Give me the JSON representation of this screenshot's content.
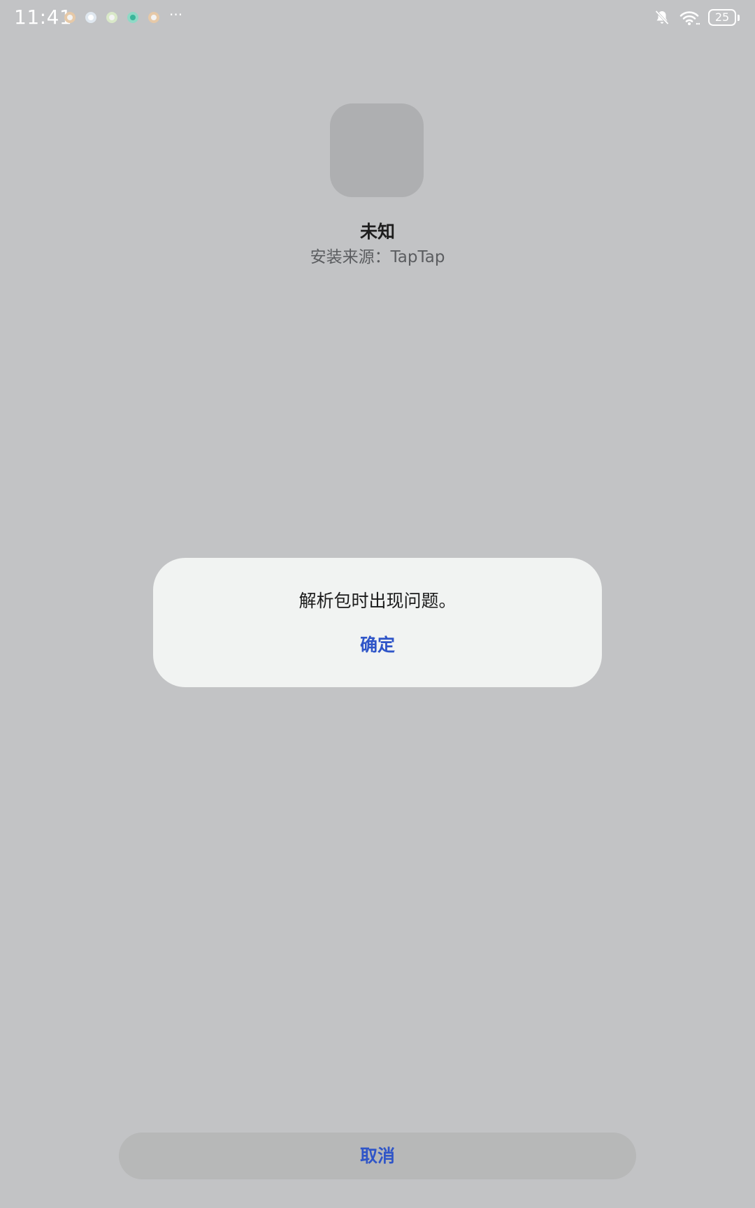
{
  "status_bar": {
    "time": "11:41",
    "more_indicator": "···",
    "battery_level": "25",
    "icons": [
      {
        "name": "mi-store-icon",
        "color": "#e6c9a8"
      },
      {
        "name": "tiktok-icon",
        "color": "#ffffff"
      },
      {
        "name": "wechat-icon",
        "color": "#d9e8c8"
      },
      {
        "name": "security-app-icon",
        "color": "#3bb59a"
      },
      {
        "name": "mi-store-icon",
        "color": "#e6c9a8"
      }
    ]
  },
  "app": {
    "name": "未知",
    "install_source": "安装来源：TapTap"
  },
  "dialog": {
    "message": "解析包时出现问题。",
    "confirm_label": "确定"
  },
  "footer": {
    "cancel_label": "取消"
  },
  "colors": {
    "background": "#c2c3c5",
    "accent": "#2f55c8",
    "dialog_bg": "#f1f3f2"
  }
}
